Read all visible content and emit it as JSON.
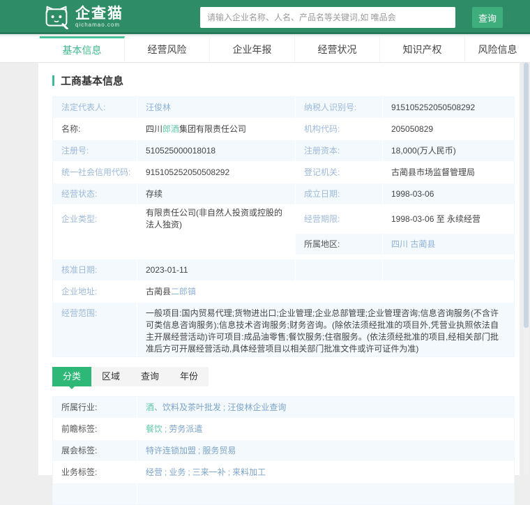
{
  "header": {
    "logo_title": "企查猫",
    "logo_subtitle": "qichamao.com",
    "search_placeholder": "请输入企业名称、人名、产品名等关键词,如 唯品会",
    "search_button": "查询"
  },
  "nav": {
    "tabs": [
      {
        "label": "基本信息",
        "active": true
      },
      {
        "label": "经营风险",
        "active": false
      },
      {
        "label": "企业年报",
        "active": false
      },
      {
        "label": "经营状况",
        "active": false
      },
      {
        "label": "知识产权",
        "active": false
      },
      {
        "label": "风险信息",
        "active": false
      }
    ]
  },
  "section": {
    "title": "工商基本信息"
  },
  "info": {
    "r1": {
      "l1": "法定代表人:",
      "v1": "汪俊林",
      "l2": "纳税人识别号:",
      "v2": "915105252050508292"
    },
    "r2": {
      "l1": "名称:",
      "v1_prefix": "四川",
      "v1_highlight": "郎酒",
      "v1_suffix": "集团有限责任公司",
      "l2": "机构代码:",
      "v2": "205050829"
    },
    "r3": {
      "l1": "注册号:",
      "v1": "510525000018018",
      "l2": "注册资本:",
      "v2": "18,000(万人民币)"
    },
    "r4": {
      "l1": "统一社会信用代码:",
      "v1": "915105252050508292",
      "l2": "登记机关:",
      "v2": "古蔺县市场监督管理局"
    },
    "r5": {
      "l1": "经营状态:",
      "v1": "存续",
      "l2": "成立日期:",
      "v2": "1998-03-06"
    },
    "r6": {
      "l1": "企业类型:",
      "v1": "有限责任公司(非自然人投资或控股的法人独资)",
      "l2": "经营期限:",
      "v2": "1998-03-06 至 永续经营"
    },
    "r7": {
      "l2": "所属地区:",
      "v2": "四川 古蔺县"
    },
    "r8": {
      "l1": "核准日期:",
      "v1": "2023-01-11"
    },
    "r9": {
      "l1": "企业地址:",
      "v1_text": "古蔺县",
      "v1_link": "二郎镇"
    },
    "r10": {
      "l1": "经营范围:",
      "v1": "一般项目:国内贸易代理;货物进出口;企业管理;企业总部管理;企业管理咨询;信息咨询服务(不含许可类信息咨询服务);信息技术咨询服务;财务咨询。(除依法须经批准的项目外,凭营业执照依法自主开展经营活动)许可项目:成品油零售;餐饮服务;住宿服务。(依法须经批准的项目,经相关部门批准后方可开展经营活动,具体经营项目以相关部门批准文件或许可证件为准)"
    }
  },
  "subtabs": {
    "items": [
      "分类",
      "区域",
      "查询",
      "年份"
    ]
  },
  "tags": {
    "r1": {
      "label": "所属行业:",
      "hl": "酒",
      "link1": "、饮料及茶叶批发",
      "link2": "汪俊林企业查询"
    },
    "r2": {
      "label": "前瞻标签:",
      "hl": "餐饮",
      "link2": "劳务派遣"
    },
    "r3": {
      "label": "展会标签:",
      "link1": "特许连锁加盟",
      "link2": "服务贸易"
    },
    "r4": {
      "label": "业务标签:",
      "link1": "经营",
      "link2": "业务",
      "link3": "三来一补",
      "link4": "来料加工"
    }
  },
  "separator": ";",
  "colors": {
    "header_green": "#2e8c66",
    "search_button_green": "#3fae7d",
    "active_tab_green": "#42b98e",
    "subtab_active_green": "#2eb878",
    "pale_row_blue": "#f3f9fd",
    "label_blue": "#9db9d9",
    "link_blue": "#7da4c8",
    "keyword_highlight_green": "#5fc7a7"
  }
}
